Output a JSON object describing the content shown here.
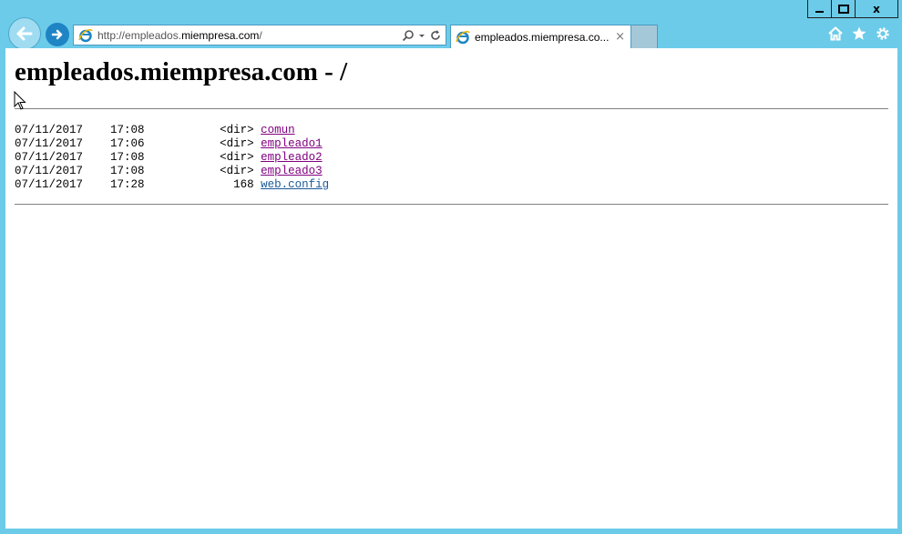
{
  "window": {
    "min_label": "",
    "max_label": "",
    "close_label": "x"
  },
  "address": {
    "url_prefix": "http://empleados.",
    "url_domain": "miempresa.com",
    "url_suffix": "/"
  },
  "tab": {
    "title": "empleados.miempresa.co...",
    "close_label": "×"
  },
  "page": {
    "heading": "empleados.miempresa.com - /",
    "entries": [
      {
        "date": "07/11/2017",
        "time": "17:08",
        "size": "<dir>",
        "name": "comun",
        "visited": true
      },
      {
        "date": "07/11/2017",
        "time": "17:06",
        "size": "<dir>",
        "name": "empleado1",
        "visited": true
      },
      {
        "date": "07/11/2017",
        "time": "17:08",
        "size": "<dir>",
        "name": "empleado2",
        "visited": true
      },
      {
        "date": "07/11/2017",
        "time": "17:08",
        "size": "<dir>",
        "name": "empleado3",
        "visited": true
      },
      {
        "date": "07/11/2017",
        "time": "17:28",
        "size": "168",
        "name": "web.config",
        "visited": false
      }
    ]
  },
  "icons": {
    "back": "back-arrow-icon",
    "forward": "forward-arrow-icon",
    "site": "ie-logo-icon",
    "search": "search-icon",
    "dropdown": "chevron-down-icon",
    "refresh": "refresh-icon",
    "home": "home-icon",
    "favorites": "star-icon",
    "tools": "gear-icon"
  },
  "colors": {
    "frame": "#6ccbe9",
    "visited_link": "#800080",
    "unvisited_link": "#1a5a9a"
  }
}
